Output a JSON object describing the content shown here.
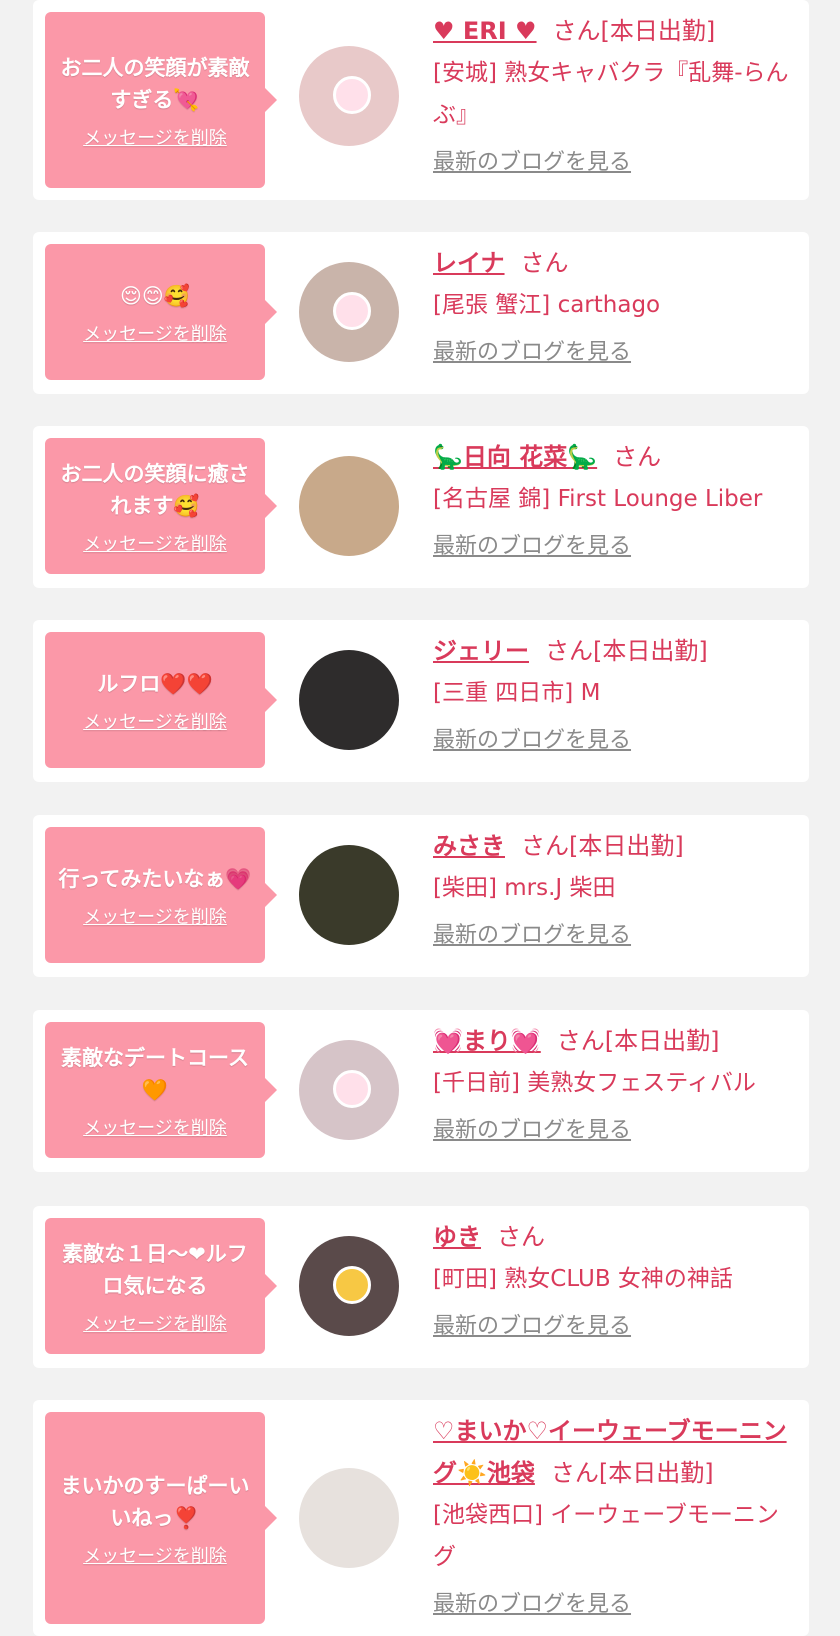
{
  "common": {
    "delete_label": "メッセージを削除",
    "blog_label": "最新のブログを見る"
  },
  "colors": {
    "background": "#f2f2f2",
    "bubble": "#fb98a8",
    "accent": "#d93a5b",
    "link_gray": "#8a8a8a"
  },
  "items": [
    {
      "message": "お二人の笑顔が素敵すぎる💘",
      "name": "♥ ERI ♥",
      "suffix": "さん[本日出勤]",
      "shop": "[安城] 熟女キャバクラ『乱舞-らんぶ』",
      "avatar_color": "#e8c9c9"
    },
    {
      "message": "😌😊🥰",
      "name": "レイナ",
      "suffix": "さん",
      "shop": "[尾張 蟹江] carthago",
      "avatar_color": "#c9b4aa"
    },
    {
      "message": "お二人の笑顔に癒されます🥰",
      "name": "🦕日向 花菜🦕",
      "suffix": "さん",
      "shop": "[名古屋 錦] First Lounge Liber",
      "avatar_color": "#c8a98a"
    },
    {
      "message": "ルフロ❤️❤️",
      "name": "ジェリー",
      "suffix": "さん[本日出勤]",
      "shop": "[三重 四日市] M",
      "avatar_color": "#2e2c2c"
    },
    {
      "message": "行ってみたいなぁ💗",
      "name": "みさき",
      "suffix": "さん[本日出勤]",
      "shop": "[柴田] mrs.J 柴田",
      "avatar_color": "#3a3a2a"
    },
    {
      "message": "素敵なデートコース🧡",
      "name": "💓まり💓",
      "suffix": "さん[本日出勤]",
      "shop": "[千日前] 美熟女フェスティバル",
      "avatar_color": "#d6c4c8"
    },
    {
      "message": "素敵な１日〜❤ルフロ気になる",
      "name": "ゆき",
      "suffix": "さん",
      "shop": "[町田] 熟女CLUB 女神の神話",
      "avatar_color": "#5a4a4a"
    },
    {
      "message": "まいかのすーぱーいいねっ❣️",
      "name": "♡まいか♡イーウェーブモーニング☀️池袋",
      "suffix": "さん[本日出勤]",
      "shop": "[池袋西口] イーウェーブモーニング",
      "avatar_color": "#e7e1dd"
    }
  ]
}
